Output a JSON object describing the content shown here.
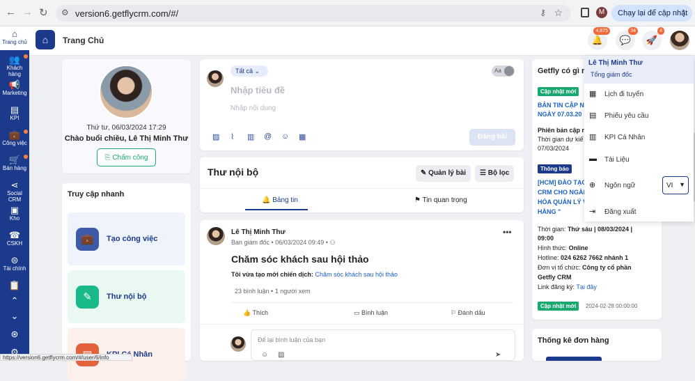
{
  "browser": {
    "url": "version6.getflycrm.com/#/",
    "profile_initial": "M",
    "update_label": "Chạy lại để cập nhật",
    "status_url": "https://version6.getflycrm.com/#/user/6/info"
  },
  "sidebar": {
    "items": [
      {
        "label": "Trang chủ",
        "icon": "home-icon"
      },
      {
        "label": "Khách hàng",
        "icon": "users-icon"
      },
      {
        "label": "Marketing",
        "icon": "megaphone-icon"
      },
      {
        "label": "KPI",
        "icon": "kpi-icon"
      },
      {
        "label": "Công việc",
        "icon": "briefcase-icon"
      },
      {
        "label": "Bán hàng",
        "icon": "cart-icon"
      },
      {
        "label": "Social CRM",
        "icon": "share-icon"
      },
      {
        "label": "Kho",
        "icon": "box-icon"
      },
      {
        "label": "CSKH",
        "icon": "phone-icon"
      },
      {
        "label": "Tài chính",
        "icon": "finance-icon"
      }
    ],
    "accent": "#1b3a8c"
  },
  "header": {
    "page_title": "Trang Chủ",
    "notif_count": "4,875",
    "chat_count": "34",
    "rocket_count": "4"
  },
  "profile": {
    "date": "Thứ tư, 06/03/2024 17:29",
    "greeting": "Chào buổi chiều, Lê Thị Minh Thư",
    "checkin_label": "Chấm công"
  },
  "quick_access": {
    "title": "Truy cập nhanh",
    "items": [
      {
        "label": "Tạo công việc",
        "icon": "briefcase-icon"
      },
      {
        "label": "Thư nội bộ",
        "icon": "edit-icon"
      },
      {
        "label": "KPI Cá Nhân",
        "icon": "kpi-icon"
      }
    ]
  },
  "compose": {
    "filter": "Tất cả",
    "toggle_text": "Aa",
    "title_placeholder": "Nhập tiêu đề",
    "content_placeholder": "Nhập nội dung",
    "post_label": "Đăng bài"
  },
  "internal": {
    "title": "Thư nội bộ",
    "manage_label": "Quản lý bài",
    "filter_label": "Bộ lọc",
    "tab_news": "Bảng tin",
    "tab_important": "Tin quan trọng"
  },
  "post": {
    "author": "Lê Thị Minh Thư",
    "dept": "Ban giám đốc",
    "timestamp": "06/03/2024 09:49",
    "headline": "Chăm sóc khách sau hội thảo",
    "line_prefix": "Tôi vừa tạo mới chiến dịch:",
    "line_link": "Chăm sóc khách sau hội thảo",
    "comments": "23 bình luận",
    "views": "1 người xem",
    "like": "Thích",
    "comment": "Bình luận",
    "bookmark": "Đánh dấu",
    "comment_placeholder": "Để lại bình luận của bạn"
  },
  "news": {
    "title": "Getfly có gì m",
    "badge1": "Cập nhật mới",
    "headline1a": "BẢN TIN CẬP N",
    "headline1b": "NGÀY 07.03.20",
    "line_a": "Phiên bản cập n",
    "line_b": "Thời gian dự kiế",
    "line_c": "07/03/2024",
    "badge2": "Thông báo",
    "headline2a": "[HCM] ĐÀO TẠO",
    "headline2b": "CRM CHO NGÀI",
    "headline2c": "HÓA QUẢN LÝ V",
    "headline2d": "HÀNG \"",
    "time_label": "Thời gian:",
    "time_value": "Thứ sáu | 08/03/2024 |",
    "time_value2": "09:00",
    "format_label": "Hình thức:",
    "format_value": "Online",
    "hotline_label": "Hotline:",
    "hotline_value": "024 6262 7662 nhánh 1",
    "org_label": "Đơn vị tổ chức:",
    "org_value": "Công ty cổ phần",
    "org_value2": "Getfly CRM",
    "register_label": "Link đăng ký:",
    "register_link": "Tại đây",
    "badge3": "Cập nhật mới",
    "date3": "2024-02-28 00:00:00"
  },
  "stats": {
    "title": "Thống kê đơn hàng"
  },
  "dropdown": {
    "name": "Lê Thị Minh Thư",
    "role": "Tổng giám đốc",
    "items": [
      {
        "label": "Lịch đi tuyến",
        "icon": "calendar-icon"
      },
      {
        "label": "Phiếu yêu cầu",
        "icon": "document-icon"
      },
      {
        "label": "KPI Cá Nhân",
        "icon": "kpi-icon"
      },
      {
        "label": "Tài Liệu",
        "icon": "folder-icon"
      },
      {
        "label": "Ngôn ngữ",
        "icon": "globe-icon"
      },
      {
        "label": "Đăng xuất",
        "icon": "logout-icon"
      }
    ],
    "language": "VI"
  }
}
